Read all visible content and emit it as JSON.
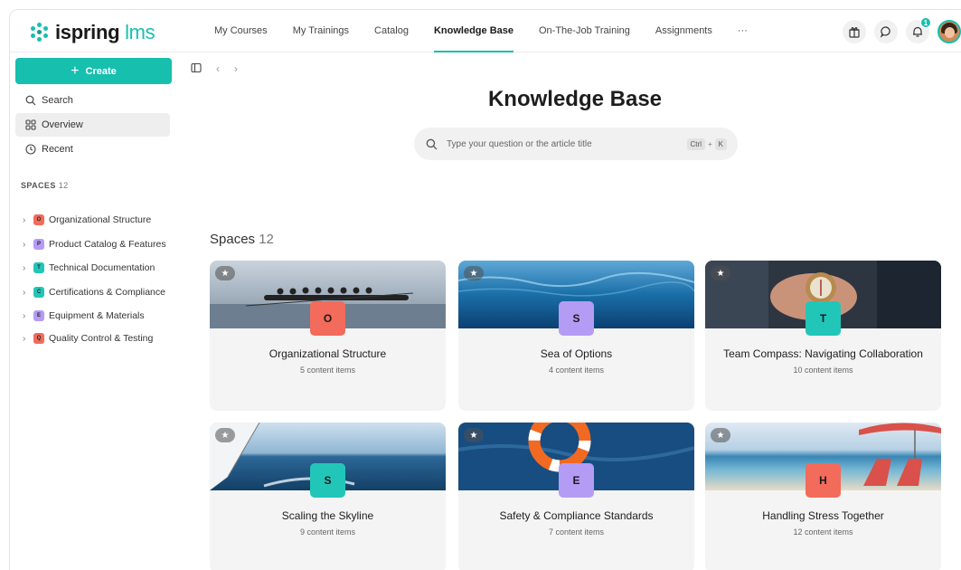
{
  "app": {
    "logo_main": "ispring",
    "logo_suffix": "lms"
  },
  "nav": {
    "items": [
      "My Courses",
      "My Trainings",
      "Catalog",
      "Knowledge Base",
      "On-The-Job Training",
      "Assignments",
      "···"
    ],
    "active": "Knowledge Base",
    "notification_count": "1"
  },
  "sidebar": {
    "create_label": "Create",
    "links": [
      "Search",
      "Overview",
      "Recent"
    ],
    "spaces_label": "SPACES",
    "spaces_count": "12",
    "spaces": [
      {
        "letter": "O",
        "label": "Organizational Structure",
        "color": "#f26b5b"
      },
      {
        "letter": "P",
        "label": "Product Catalog & Features",
        "color": "#b49cf5"
      },
      {
        "letter": "T",
        "label": "Technical Documentation",
        "color": "#22c6b8"
      },
      {
        "letter": "C",
        "label": "Certifications & Compliance",
        "color": "#22c6b8"
      },
      {
        "letter": "E",
        "label": "Equipment & Materials",
        "color": "#b49cf5"
      },
      {
        "letter": "Q",
        "label": "Quality Control & Testing",
        "color": "#f26b5b"
      }
    ]
  },
  "main": {
    "title": "Knowledge Base",
    "search_placeholder": "Type your question or the article title",
    "shortcut_ctrl": "Ctrl",
    "shortcut_plus": "+",
    "shortcut_key": "K",
    "section_label": "Spaces",
    "section_count": "12",
    "cards": [
      {
        "letter": "O",
        "title": "Organizational Structure",
        "sub": "5 content items",
        "color": "#f26b5b",
        "image": "rowing-team"
      },
      {
        "letter": "S",
        "title": "Sea of Options",
        "sub": "4 content items",
        "color": "#b49cf5",
        "image": "underwater"
      },
      {
        "letter": "T",
        "title": "Team Compass: Navigating Collaboration",
        "sub": "10 content items",
        "color": "#22c6b8",
        "image": "compass-hands"
      },
      {
        "letter": "S",
        "title": "Scaling the Skyline",
        "sub": "9 content items",
        "color": "#22c6b8",
        "image": "sailboat"
      },
      {
        "letter": "E",
        "title": "Safety & Compliance Standards",
        "sub": "7 content items",
        "color": "#b49cf5",
        "image": "life-ring"
      },
      {
        "letter": "H",
        "title": "Handling Stress Together",
        "sub": "12 content items",
        "color": "#f26b5b",
        "image": "beach-chairs"
      }
    ]
  }
}
